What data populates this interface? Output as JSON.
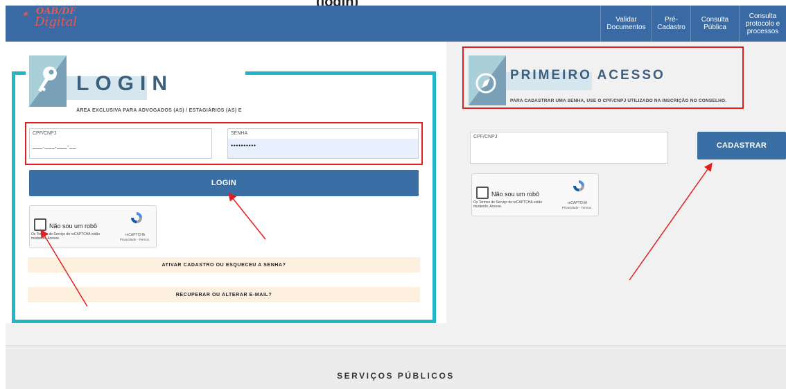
{
  "header": {
    "partial_title": "(login)",
    "logo": {
      "line1": "OAB/DF",
      "line2": "Digital"
    },
    "nav": [
      {
        "label": "Validar Documentos"
      },
      {
        "label": "Pré-Cadastro"
      },
      {
        "label": "Consulta Pública"
      },
      {
        "label": "Consulta protocolo e processos"
      }
    ]
  },
  "login": {
    "title": "LOGIN",
    "subtitle": "ÁREA EXCLUSIVA PARA ADVOGADOS (AS) / ESTAGIÁRIOS (AS) E",
    "cpf_label": "CPF/CNPJ",
    "cpf_value": "___.___.___-__",
    "senha_label": "SENHA",
    "senha_value": "••••••••••",
    "login_button": "LOGIN",
    "captcha": {
      "label": "Não sou um robô",
      "terms": "Os Termos de Serviço do reCAPTCHA estão mudando. Acesse.",
      "brand": "reCAPTCHA",
      "links": "Privacidade - Termos"
    },
    "activate_link": "ATIVAR CADASTRO OU ESQUECEU A SENHA?",
    "recover_link": "RECUPERAR OU ALTERAR E-MAIL?"
  },
  "primeiro_acesso": {
    "title": "PRIMEIRO ACESSO",
    "subtitle": "PARA CADASTRAR UMA SENHA, USE O CPF/CNPJ UTILIZADO NA INSCRIÇÃO NO CONSELHO.",
    "cpf_label": "CPF/CNPJ",
    "cadastrar_button": "CADASTRAR",
    "captcha": {
      "label": "Não sou um robô",
      "terms": "Os Termos de Serviço do reCAPTCHA estão mudando. Acesse.",
      "brand": "reCAPTCHA",
      "links": "Privacidade - Termos"
    }
  },
  "footer": {
    "servicos": "SERVIÇOS PÚBLICOS"
  },
  "colors": {
    "header_blue": "#3a6aa3",
    "frame_cyan": "#22b5c8",
    "annotation_red": "#e02020",
    "button_blue": "#3a6fa6",
    "cream": "#fdf0de"
  }
}
